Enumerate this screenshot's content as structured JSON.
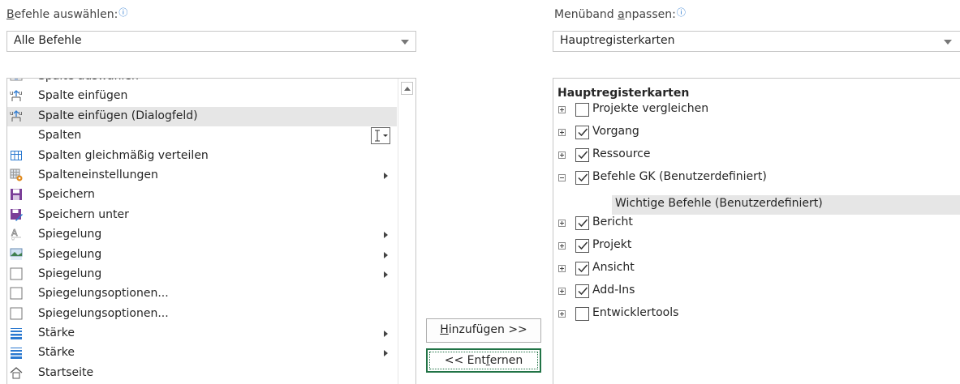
{
  "left_panel": {
    "label_pre": "",
    "label_u": "B",
    "label_post": "efehle auswählen:",
    "info_icon": "info-icon",
    "combo_value": "Alle Befehle",
    "commands": [
      {
        "label": "Spalte auswählen",
        "icon": "column-select-icon",
        "submenu": false
      },
      {
        "label": "Spalte einfügen",
        "icon": "insert-column-icon",
        "submenu": false
      },
      {
        "label": "Spalte einfügen (Dialogfeld)",
        "icon": "insert-column-dialog-icon",
        "submenu": false,
        "selected": true
      },
      {
        "label": "Spalten",
        "icon": "",
        "submenu": false,
        "ibeam": true
      },
      {
        "label": "Spalten gleichmäßig verteilen",
        "icon": "distribute-columns-icon",
        "submenu": false
      },
      {
        "label": "Spalteneinstellungen",
        "icon": "column-settings-icon",
        "submenu": true
      },
      {
        "label": "Speichern",
        "icon": "save-icon",
        "submenu": false
      },
      {
        "label": "Speichern unter",
        "icon": "save-as-icon",
        "submenu": false
      },
      {
        "label": "Spiegelung",
        "icon": "mirror-text-icon",
        "submenu": true
      },
      {
        "label": "Spiegelung",
        "icon": "mirror-picture-icon",
        "submenu": true
      },
      {
        "label": "Spiegelung",
        "icon": "mirror-shape-icon",
        "submenu": true
      },
      {
        "label": "Spiegelungsoptionen...",
        "icon": "mirror-options-icon",
        "submenu": false
      },
      {
        "label": "Spiegelungsoptionen...",
        "icon": "mirror-options-icon",
        "submenu": false
      },
      {
        "label": "Stärke",
        "icon": "line-weight-icon",
        "submenu": true
      },
      {
        "label": "Stärke",
        "icon": "line-weight-icon",
        "submenu": true
      },
      {
        "label": "Startseite",
        "icon": "home-icon",
        "submenu": false
      }
    ]
  },
  "buttons": {
    "add_u": "H",
    "add_post": "inzufügen >>",
    "remove_pre": "<< Ent",
    "remove_u": "f",
    "remove_post": "ernen"
  },
  "right_panel": {
    "label_pre": "Menüband ",
    "label_u": "a",
    "label_post": "npassen:",
    "info_icon": "info-icon",
    "combo_value": "Hauptregisterkarten",
    "tree_header": "Hauptregisterkarten",
    "tabs": [
      {
        "label": "Projekte vergleichen",
        "checked": false,
        "expanded": false
      },
      {
        "label": "Vorgang",
        "checked": true,
        "expanded": false
      },
      {
        "label": "Ressource",
        "checked": true,
        "expanded": false
      },
      {
        "label": "Befehle GK (Benutzerdefiniert)",
        "checked": true,
        "expanded": true
      },
      {
        "label": "Bericht",
        "checked": true,
        "expanded": false
      },
      {
        "label": "Projekt",
        "checked": true,
        "expanded": false
      },
      {
        "label": "Ansicht",
        "checked": true,
        "expanded": false
      },
      {
        "label": "Add-Ins",
        "checked": true,
        "expanded": false
      },
      {
        "label": "Entwicklertools",
        "checked": false,
        "expanded": false
      }
    ],
    "group_label": "Wichtige Befehle (Benutzerdefiniert)"
  },
  "colors": {
    "accent": "#217346",
    "info": "#2b79d0",
    "selection": "#e6e6e6"
  }
}
